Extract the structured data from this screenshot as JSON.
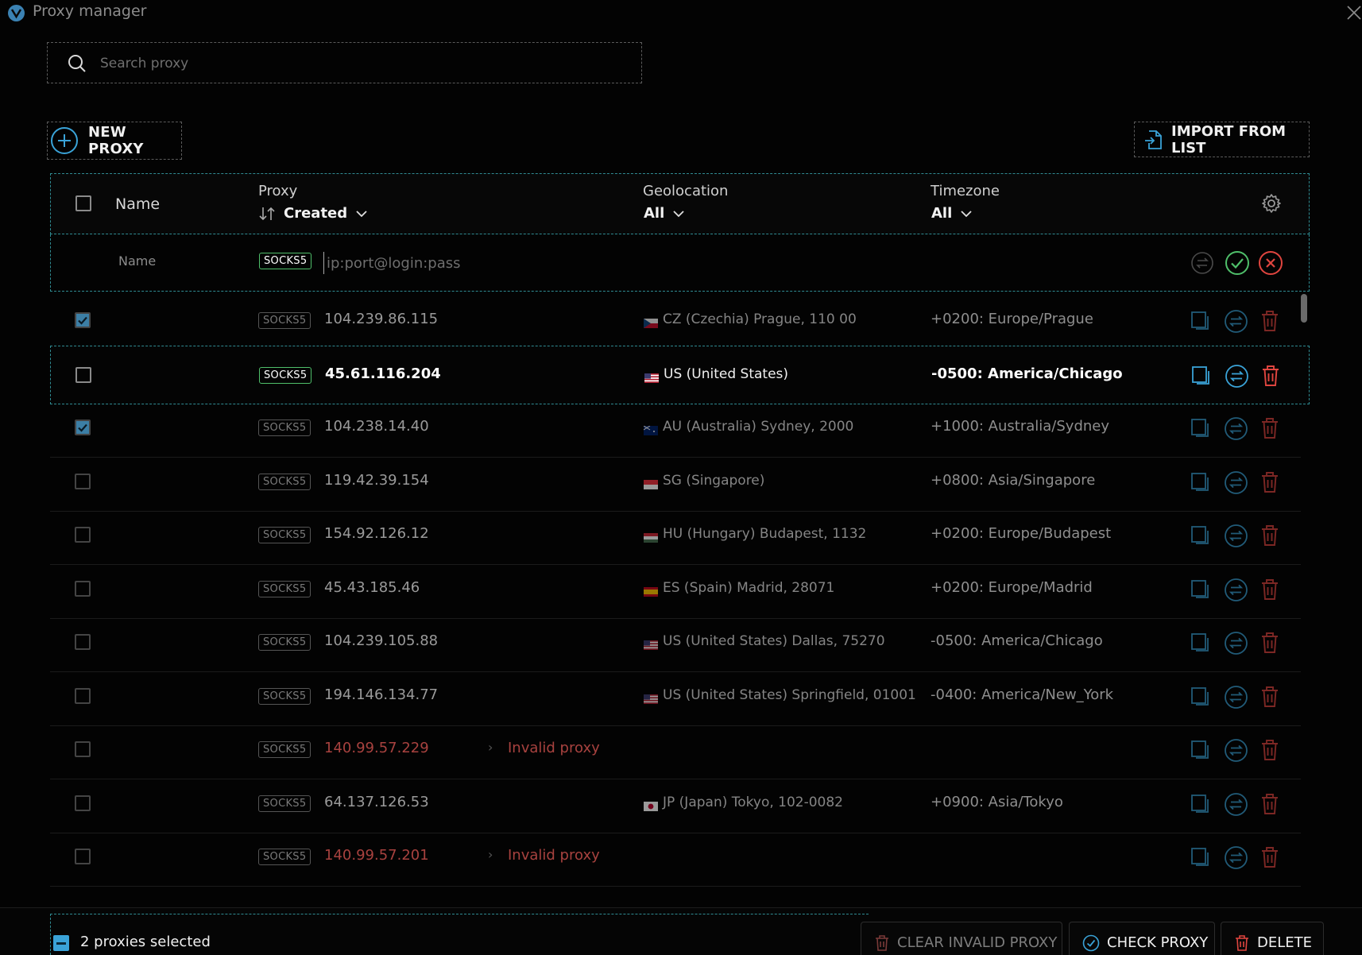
{
  "window": {
    "title": "Proxy manager"
  },
  "search": {
    "placeholder": "Search proxy"
  },
  "toolbar": {
    "new_label": "NEW PROXY",
    "import_label": "IMPORT FROM LIST"
  },
  "columns": {
    "name": "Name",
    "proxy": "Proxy",
    "sort": "Created",
    "geolocation": "Geolocation",
    "geolocation_filter": "All",
    "timezone": "Timezone",
    "timezone_filter": "All"
  },
  "new_row": {
    "name_placeholder": "Name",
    "type": "SOCKS5",
    "placeholder": "ip:port@login:pass"
  },
  "rows": [
    {
      "checked": true,
      "type": "SOCKS5",
      "ip": "104.239.86.115",
      "flag": "cz",
      "geo": "CZ (Czechia) Prague, 110 00",
      "tz": "+0200: Europe/Prague"
    },
    {
      "checked": false,
      "type": "SOCKS5",
      "ip": "45.61.116.204",
      "flag": "us",
      "geo": "US (United States)",
      "tz": "-0500: America/Chicago",
      "highlight": true
    },
    {
      "checked": true,
      "type": "SOCKS5",
      "ip": "104.238.14.40",
      "flag": "au",
      "geo": "AU (Australia) Sydney, 2000",
      "tz": "+1000: Australia/Sydney"
    },
    {
      "checked": false,
      "type": "SOCKS5",
      "ip": "119.42.39.154",
      "flag": "sg",
      "geo": "SG (Singapore)",
      "tz": "+0800: Asia/Singapore"
    },
    {
      "checked": false,
      "type": "SOCKS5",
      "ip": "154.92.126.12",
      "flag": "hu",
      "geo": "HU (Hungary) Budapest, 1132",
      "tz": "+0200: Europe/Budapest"
    },
    {
      "checked": false,
      "type": "SOCKS5",
      "ip": "45.43.185.46",
      "flag": "es",
      "geo": "ES (Spain) Madrid, 28071",
      "tz": "+0200: Europe/Madrid"
    },
    {
      "checked": false,
      "type": "SOCKS5",
      "ip": "104.239.105.88",
      "flag": "us",
      "geo": "US (United States) Dallas, 75270",
      "tz": "-0500: America/Chicago"
    },
    {
      "checked": false,
      "type": "SOCKS5",
      "ip": "194.146.134.77",
      "flag": "us",
      "geo": "US (United States) Springfield, 01001",
      "tz": "-0400: America/New_York"
    },
    {
      "checked": false,
      "type": "SOCKS5",
      "ip": "140.99.57.229",
      "invalid": true,
      "status": "Invalid proxy"
    },
    {
      "checked": false,
      "type": "SOCKS5",
      "ip": "64.137.126.53",
      "flag": "jp",
      "geo": "JP (Japan) Tokyo, 102-0082",
      "tz": "+0900: Asia/Tokyo"
    },
    {
      "checked": false,
      "type": "SOCKS5",
      "ip": "140.99.57.201",
      "invalid": true,
      "status": "Invalid proxy"
    }
  ],
  "footer": {
    "selected_text": "2 proxies selected",
    "clear_label": "CLEAR INVALID PROXY",
    "check_label": "CHECK PROXY",
    "delete_label": "DELETE"
  },
  "colors": {
    "accent": "#3aa3d8",
    "success": "#4fbf6a",
    "danger": "#e0453f",
    "invalid": "#a8423f"
  }
}
